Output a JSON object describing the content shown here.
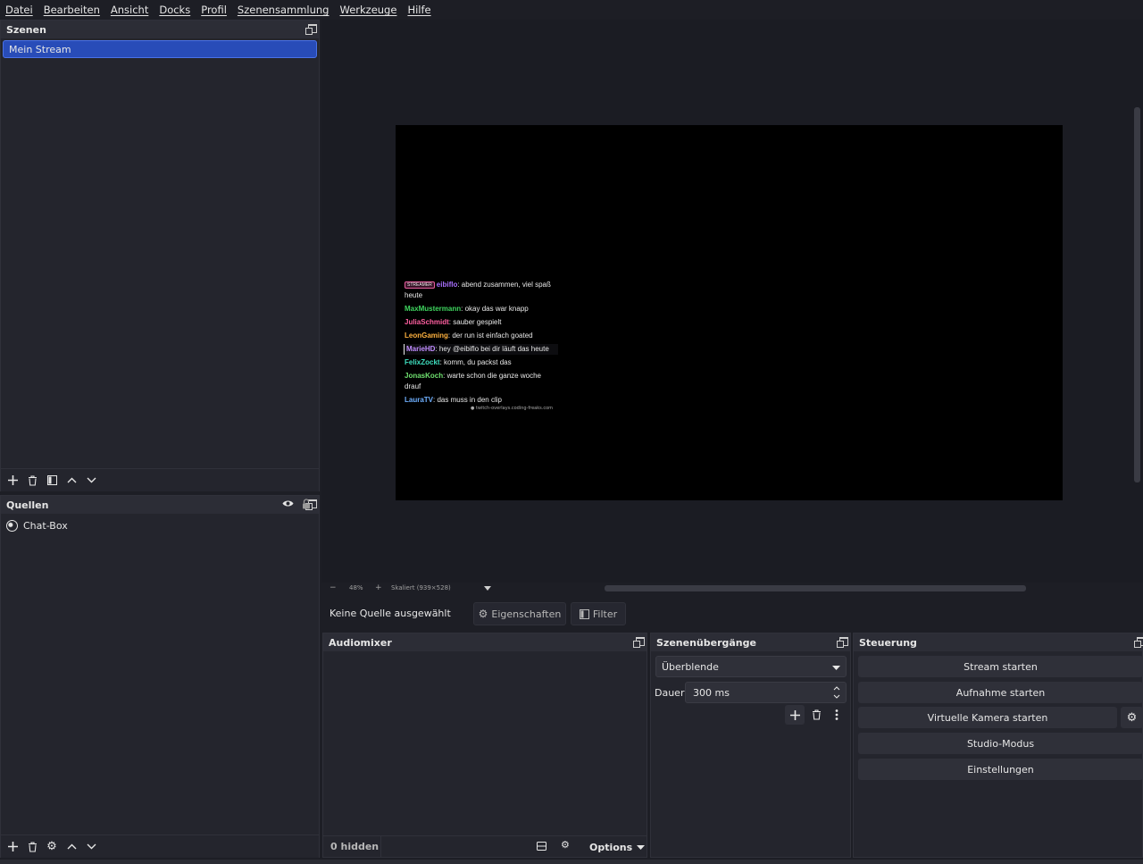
{
  "menubar": {
    "items": [
      "Datei",
      "Bearbeiten",
      "Ansicht",
      "Docks",
      "Profil",
      "Szenensammlung",
      "Werkzeuge",
      "Hilfe"
    ]
  },
  "scenes": {
    "title": "Szenen",
    "items": [
      "Mein Stream"
    ]
  },
  "sources": {
    "title": "Quellen",
    "items": [
      "Chat-Box"
    ]
  },
  "preview": {
    "zoom": "48%",
    "scale_label": "Skaliert (939×528)"
  },
  "chat": {
    "messages": [
      {
        "badge": "STREAMER",
        "user": "eibiflo",
        "color": "#a970ff",
        "text": "abend zusammen, viel spaß heute"
      },
      {
        "user": "MaxMustermann",
        "color": "#3fd65f",
        "text": "okay das war knapp"
      },
      {
        "user": "JuliaSchmidt",
        "color": "#ff5fa0",
        "text": "sauber gespielt"
      },
      {
        "user": "LeonGaming",
        "color": "#ffb23f",
        "text": "der run ist einfach goated"
      },
      {
        "user": "MarieHD",
        "color": "#c08cff",
        "text": "hey @eibiflo bei dir läuft das heute"
      },
      {
        "user": "FelixZockt",
        "color": "#3fe0c0",
        "text": "komm, du packst das"
      },
      {
        "user": "JonasKoch",
        "color": "#6fe06f",
        "text": "warte schon die ganze woche drauf"
      },
      {
        "user": "LauraTV",
        "color": "#6fb0ff",
        "text": "das muss in den clip"
      }
    ],
    "footer": "● twitch-overlays.coding-freaks.com"
  },
  "propbar": {
    "no_source": "Keine Quelle ausgewählt",
    "properties": "Eigenschaften",
    "filter": "Filter"
  },
  "audiomixer": {
    "title": "Audiomixer",
    "hidden": "0 hidden",
    "options": "Options"
  },
  "transitions": {
    "title": "Szenenübergänge",
    "selected": "Überblende",
    "duration_label": "Dauer",
    "duration_value": "300 ms"
  },
  "controls": {
    "title": "Steuerung",
    "stream": "Stream starten",
    "record": "Aufnahme starten",
    "virtualcam": "Virtuelle Kamera starten",
    "studio": "Studio-Modus",
    "settings": "Einstellungen"
  }
}
